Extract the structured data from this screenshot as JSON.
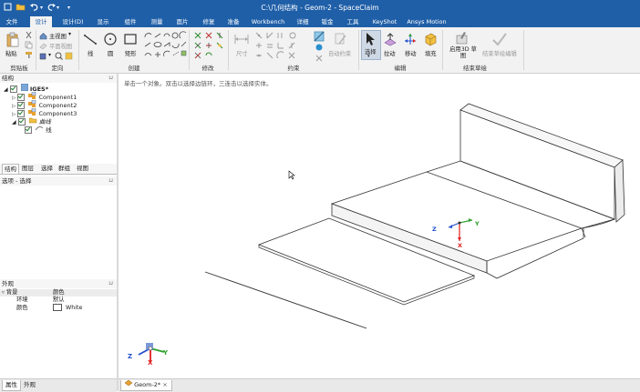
{
  "window": {
    "title": "C:\\几何结构 - Geom-2 - SpaceClaim"
  },
  "quick_access": {
    "file_icon": "folder-icon",
    "undo_icon": "undo-icon",
    "redo_icon": "redo-icon",
    "customize": "▾"
  },
  "tabs": [
    {
      "label": "文件"
    },
    {
      "label": "设计"
    },
    {
      "label": "设计(D)"
    },
    {
      "label": "显示"
    },
    {
      "label": "组件"
    },
    {
      "label": "测量"
    },
    {
      "label": "面片"
    },
    {
      "label": "修复"
    },
    {
      "label": "准备"
    },
    {
      "label": "Workbench"
    },
    {
      "label": "详细"
    },
    {
      "label": "钣金"
    },
    {
      "label": "工具"
    },
    {
      "label": "KeyShot"
    },
    {
      "label": "Ansys Motion"
    }
  ],
  "ribbon": {
    "clipboard": {
      "paste": "粘贴",
      "group": "剪贴板"
    },
    "orient": {
      "home_view": "主视图",
      "plane_view": "平面视图",
      "group": "定向"
    },
    "sketch": {
      "line": "线",
      "circle": "圆",
      "rectangle": "矩形",
      "group": "创建"
    },
    "modify": {
      "group": "修改"
    },
    "constraint": {
      "dimension": "尺寸",
      "auto_constraint": "自动约束",
      "group": "约束"
    },
    "edit": {
      "select": "选择",
      "pull": "拉动",
      "move": "移动",
      "fill": "填充",
      "group": "编辑"
    },
    "finish": {
      "enable_3d": "启用3D 草图",
      "finish_edit": "结束草绘编辑",
      "group": "结束草绘"
    }
  },
  "structure": {
    "header": "结构",
    "pin": "⊔",
    "root": "IGES*",
    "items": [
      "Component1",
      "Component2",
      "Component3"
    ],
    "curves": "曲线",
    "curves_child": "线"
  },
  "structure_tabs": [
    "结构",
    "图层",
    "选择",
    "群组",
    "视图"
  ],
  "options": {
    "header": "选项 - 选择",
    "pin": "⊔"
  },
  "appearance": {
    "header": "外观",
    "pin": "⊔",
    "section": "背景",
    "section_value": "颜色",
    "rows": [
      {
        "name": "环境",
        "value": "默认"
      },
      {
        "name": "颜色",
        "value": "White"
      }
    ]
  },
  "left_bottom_tabs": [
    "属性",
    "外观"
  ],
  "viewport": {
    "hint": "单击一个对象。双击以选择边链环，三连击以选择实体。",
    "axes": {
      "x": "X",
      "y": "Y",
      "z": "Z"
    }
  },
  "document_tab": {
    "label": "Geom-2*",
    "close": "×"
  },
  "colors": {
    "title_bar": "#1f5fa8",
    "ribbon": "#f2f2f2",
    "axis_x": "#e02020",
    "axis_y": "#2aa02a",
    "axis_z": "#2050d0"
  }
}
